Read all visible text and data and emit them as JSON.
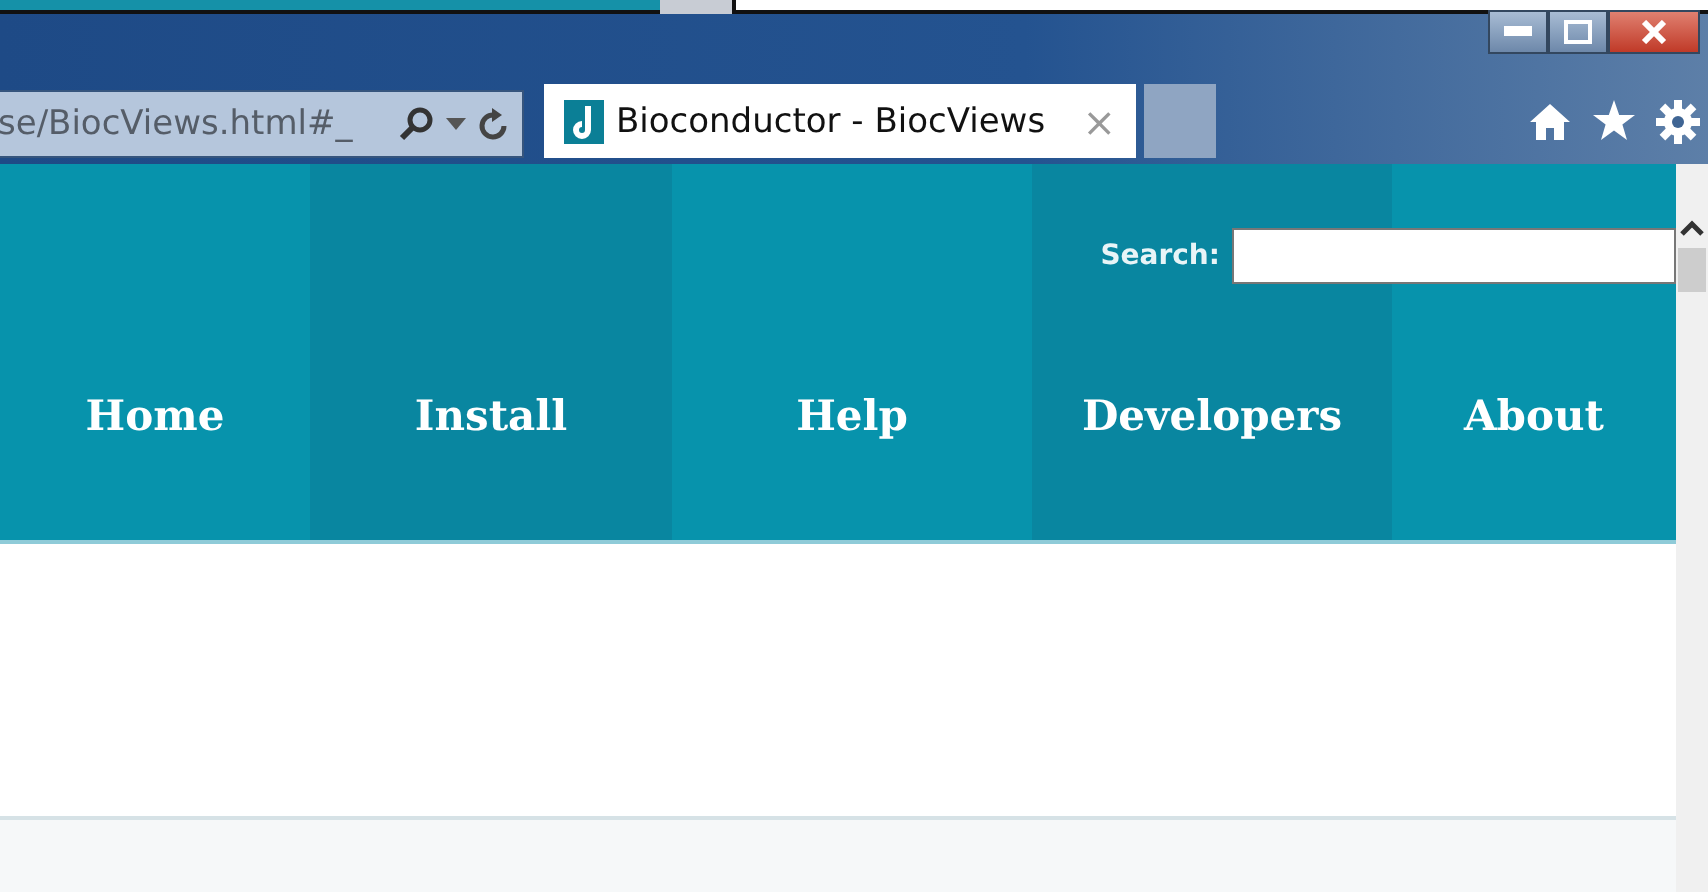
{
  "address_bar": {
    "url": "se/BiocViews.html#_"
  },
  "tabs": [
    {
      "title": "Bioconductor - BiocViews",
      "close": "×",
      "selected": true
    }
  ],
  "search": {
    "label": "Search:"
  },
  "nav": [
    {
      "label": "Home"
    },
    {
      "label": "Install"
    },
    {
      "label": "Help"
    },
    {
      "label": "Developers"
    },
    {
      "label": "About"
    }
  ]
}
